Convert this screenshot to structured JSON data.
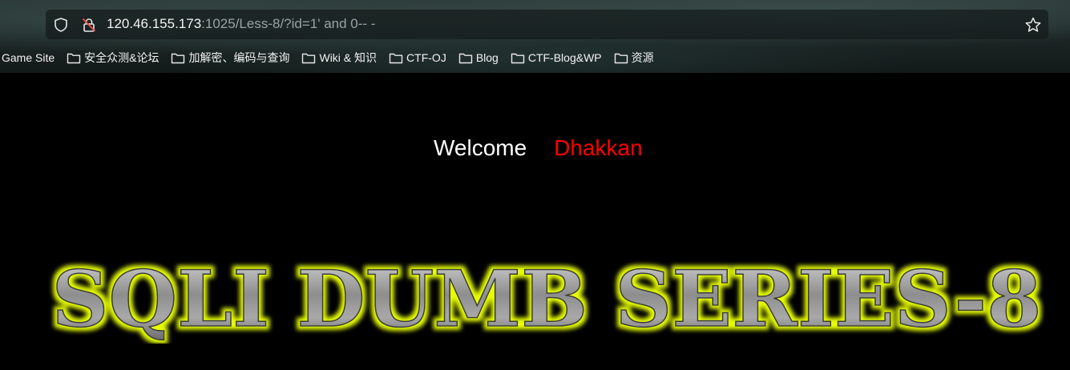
{
  "browser": {
    "url_host": "120.46.155.173",
    "url_path": ":1025/Less-8/?id=1' and 0-- -",
    "bookmarks": [
      {
        "label": "Game Site",
        "folder": false
      },
      {
        "label": "安全众测&论坛",
        "folder": true
      },
      {
        "label": "加解密、编码与查询",
        "folder": true
      },
      {
        "label": "Wiki & 知识",
        "folder": true
      },
      {
        "label": "CTF-OJ",
        "folder": true
      },
      {
        "label": "Blog",
        "folder": true
      },
      {
        "label": "CTF-Blog&WP",
        "folder": true
      },
      {
        "label": "资源",
        "folder": true
      }
    ],
    "icons": {
      "shield": "shield-icon",
      "lock": "insecure-lock-icon",
      "star": "star-icon",
      "folder": "folder-icon"
    }
  },
  "page": {
    "welcome_label": "Welcome",
    "welcome_name": "Dhakkan",
    "banner_text": "SQLI DUMB SERIES-8",
    "colors": {
      "background": "#000000",
      "welcome": "#ffffff",
      "name": "#ff0000",
      "banner_fill": "#8f8f8f",
      "banner_glow": "#e8ff00"
    }
  }
}
